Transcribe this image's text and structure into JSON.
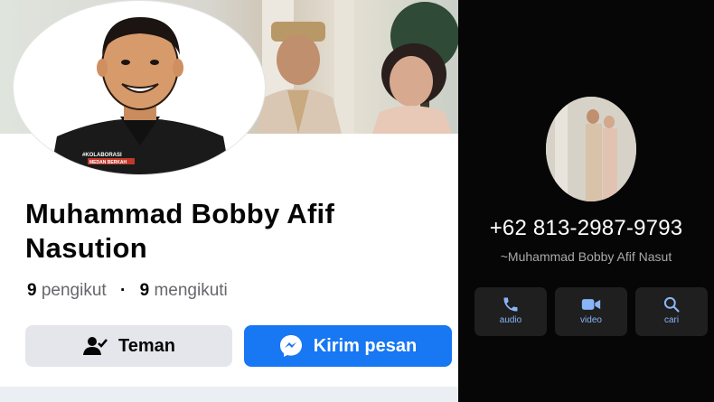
{
  "profile": {
    "name": "Muhammad Bobby Afif Nasution",
    "followers_count": "9",
    "followers_label": "pengikut",
    "following_count": "9",
    "following_label": "mengikuti",
    "friend_button": "Teman",
    "message_button": "Kirim pesan",
    "avatar_shirt_text_line1": "#KOLABORASI",
    "avatar_shirt_text_line2": "MEDAN BERKAH"
  },
  "contact": {
    "phone": "+62 813-2987-9793",
    "name": "~Muhammad Bobby Afif Nasut",
    "actions": [
      {
        "label": "audio",
        "icon": "phone-icon"
      },
      {
        "label": "video",
        "icon": "video-icon"
      },
      {
        "label": "cari",
        "icon": "search-icon"
      }
    ]
  },
  "colors": {
    "facebook_blue": "#1877f2",
    "dark_background": "#060606",
    "action_icon": "#8ab4f8"
  }
}
